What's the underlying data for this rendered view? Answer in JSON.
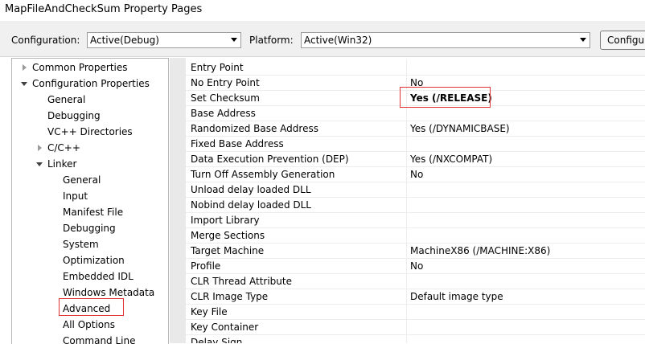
{
  "window": {
    "title": "MapFileAndCheckSum Property Pages"
  },
  "config_bar": {
    "configuration_label": "Configuration:",
    "configuration_value": "Active(Debug)",
    "platform_label": "Platform:",
    "platform_value": "Active(Win32)",
    "config_manager_button": "Configu"
  },
  "tree": [
    {
      "label": "Common Properties"
    },
    {
      "label": "Configuration Properties"
    },
    {
      "label": "General"
    },
    {
      "label": "Debugging"
    },
    {
      "label": "VC++ Directories"
    },
    {
      "label": "C/C++"
    },
    {
      "label": "Linker"
    },
    {
      "label": "General"
    },
    {
      "label": "Input"
    },
    {
      "label": "Manifest File"
    },
    {
      "label": "Debugging"
    },
    {
      "label": "System"
    },
    {
      "label": "Optimization"
    },
    {
      "label": "Embedded IDL"
    },
    {
      "label": "Windows Metadata"
    },
    {
      "label": "Advanced"
    },
    {
      "label": "All Options"
    },
    {
      "label": "Command Line"
    }
  ],
  "properties": [
    {
      "name": "Entry Point",
      "value": ""
    },
    {
      "name": "No Entry Point",
      "value": "No"
    },
    {
      "name": "Set Checksum",
      "value": "Yes (/RELEASE)"
    },
    {
      "name": "Base Address",
      "value": ""
    },
    {
      "name": "Randomized Base Address",
      "value": "Yes (/DYNAMICBASE)"
    },
    {
      "name": "Fixed Base Address",
      "value": ""
    },
    {
      "name": "Data Execution Prevention (DEP)",
      "value": "Yes (/NXCOMPAT)"
    },
    {
      "name": "Turn Off Assembly Generation",
      "value": "No"
    },
    {
      "name": "Unload delay loaded DLL",
      "value": ""
    },
    {
      "name": "Nobind delay loaded DLL",
      "value": ""
    },
    {
      "name": "Import Library",
      "value": ""
    },
    {
      "name": "Merge Sections",
      "value": ""
    },
    {
      "name": "Target Machine",
      "value": "MachineX86 (/MACHINE:X86)"
    },
    {
      "name": "Profile",
      "value": "No"
    },
    {
      "name": "CLR Thread Attribute",
      "value": ""
    },
    {
      "name": "CLR Image Type",
      "value": "Default image type"
    },
    {
      "name": "Key File",
      "value": ""
    },
    {
      "name": "Key Container",
      "value": ""
    },
    {
      "name": "Delay Sign",
      "value": ""
    }
  ],
  "colors": {
    "highlight_border": "#e23232"
  }
}
